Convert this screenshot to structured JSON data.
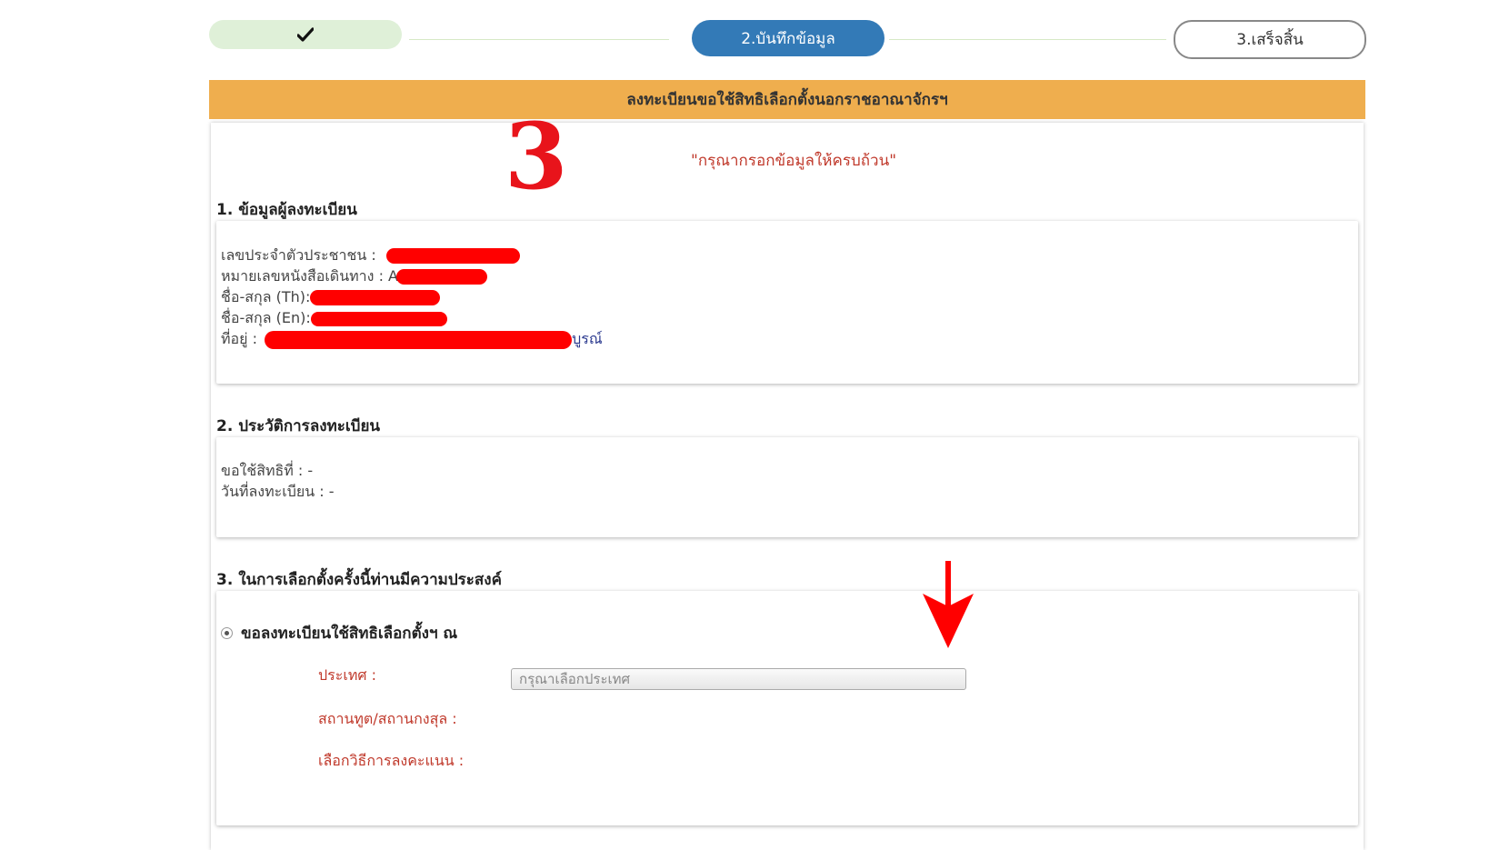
{
  "stepper": {
    "step1_check": "✔",
    "step2_label": "2.บันทึกข้อมูล",
    "step3_label": "3.เสร็จสิ้น"
  },
  "banner": {
    "title": "ลงทะเบียนขอใช้สิทธิเลือกตั้งนอกราชอาณาจักรฯ"
  },
  "annotation_number": "3",
  "notice": "\"กรุณากรอกข้อมูลให้ครบถ้วน\"",
  "section1": {
    "title": "1. ข้อมูลผู้ลงทะเบียน",
    "id_label": "เลขประจำตัวประชาชน :",
    "passport_label": "หมายเลขหนังสือเดินทาง : A",
    "name_th_label": "ชื่อ-สกุล (Th):",
    "name_en_label": "ชื่อ-สกุล (En):",
    "address_label": "ที่อยู่ :",
    "address_tail": "บูรณ์"
  },
  "section2": {
    "title": "2. ประวัติการลงทะเบียน",
    "right_no": "ขอใช้สิทธิที่ : -",
    "reg_date": "วันที่ลงทะเบียน : -"
  },
  "section3": {
    "title": "3. ในการเลือกตั้งครั้งนี้ท่านมีความประสงค์",
    "option_label": "ขอลงทะเบียนใช้สิทธิเลือกตั้งฯ ณ",
    "country_label": "ประเทศ :",
    "country_placeholder": "กรุณาเลือกประเทศ",
    "embassy_label": "สถานทูต/สถานกงสุล :",
    "method_label": "เลือกวิธีการลงคะแนน :"
  },
  "colors": {
    "banner": "#efae4e",
    "active_step": "#337ab7",
    "done_step": "#dff0d8",
    "annotation_red": "#e8141b"
  }
}
